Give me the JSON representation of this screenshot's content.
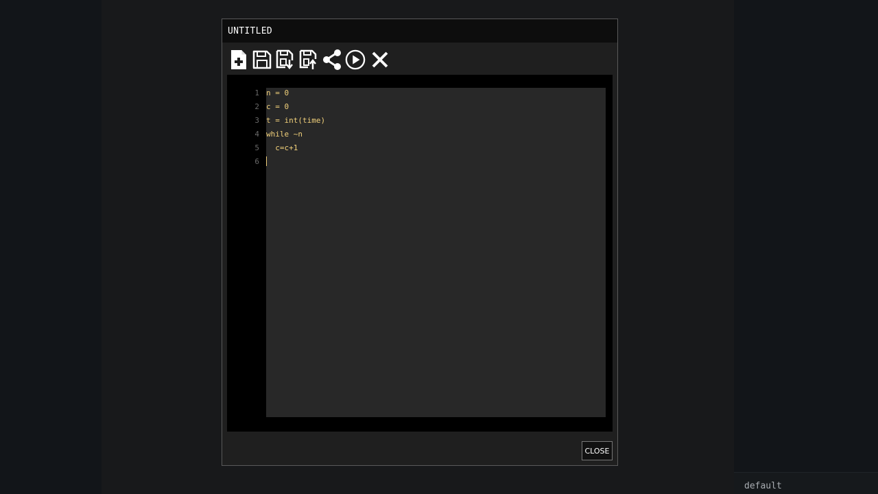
{
  "background": {
    "left": "#121519",
    "center": "#18191b",
    "right": "#121519"
  },
  "dialog": {
    "title": "UNTITLED",
    "toolbar": [
      {
        "name": "new-file-icon"
      },
      {
        "name": "save-icon"
      },
      {
        "name": "save-download-icon"
      },
      {
        "name": "save-upload-icon"
      },
      {
        "name": "share-icon"
      },
      {
        "name": "run-icon"
      },
      {
        "name": "close-icon"
      }
    ],
    "editor": {
      "lines": [
        {
          "num": "1",
          "text": "n = 0"
        },
        {
          "num": "2",
          "text": "c = 0"
        },
        {
          "num": "3",
          "text": "t = int(time)"
        },
        {
          "num": "4",
          "text": "while ~n"
        },
        {
          "num": "5",
          "text": "  c=c+1"
        },
        {
          "num": "6",
          "text": ""
        }
      ],
      "text_color": "#f1d07a",
      "line_number_color": "#6a6a6a"
    },
    "close_label": "CLOSE"
  },
  "status_bar": {
    "label": "default"
  }
}
